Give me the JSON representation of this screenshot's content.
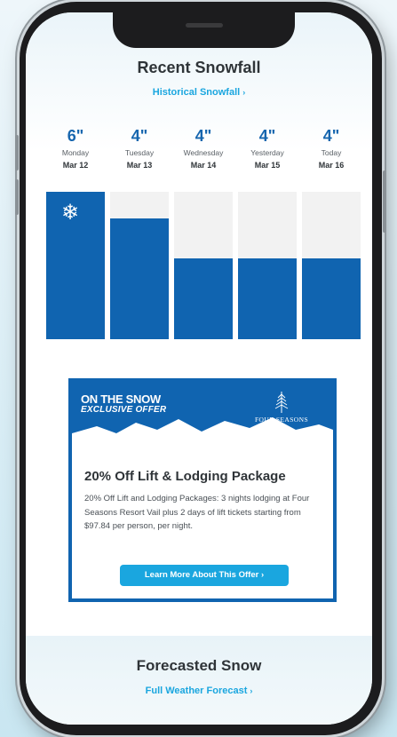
{
  "recent": {
    "title": "Recent Snowfall",
    "history_link": "Historical Snowfall",
    "chevron": "›"
  },
  "days": [
    {
      "amount": "6\"",
      "day": "Monday",
      "date": "Mar 12",
      "level": 1.0,
      "icon": "snowflake-icon"
    },
    {
      "amount": "4\"",
      "day": "Tuesday",
      "date": "Mar 13",
      "level": 0.82
    },
    {
      "amount": "4\"",
      "day": "Wednesday",
      "date": "Mar 14",
      "level": 0.55
    },
    {
      "amount": "4\"",
      "day": "Yesterday",
      "date": "Mar 15",
      "level": 0.55
    },
    {
      "amount": "4\"",
      "day": "Today",
      "date": "Mar 16",
      "level": 0.55
    }
  ],
  "snowflake_glyph": "❄",
  "offer": {
    "brand_line1": "ON THE SNOW",
    "brand_line2": "EXCLUSIVE OFFER",
    "partner": "FOUR SEASONS",
    "title": "20% Off Lift & Lodging Package",
    "description": "20% Off Lift and Lodging Packages: 3 nights lodging at Four Seasons Resort Vail plus 2 days of lift tickets starting from $97.84 per person, per night.",
    "button": "Learn More About This Offer",
    "chevron": "›"
  },
  "forecast": {
    "title": "Forecasted Snow",
    "link": "Full Weather Forecast",
    "chevron": "›"
  },
  "colors": {
    "bar": "#1064b0",
    "bar_bg": "#f2f2f2",
    "accent": "#1aa6df",
    "amount": "#1666ae",
    "text": "#2f3438"
  }
}
